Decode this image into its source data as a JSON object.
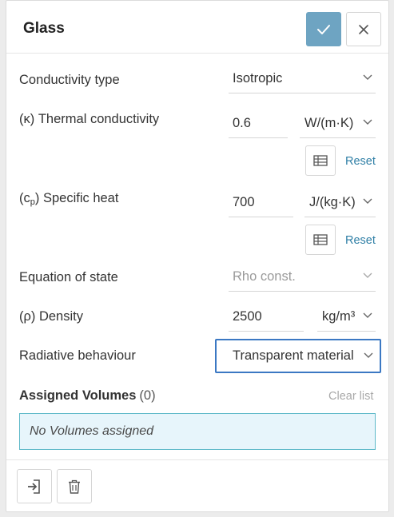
{
  "header": {
    "title": "Glass",
    "confirm_icon": "check-icon",
    "close_icon": "close-icon"
  },
  "colors": {
    "confirm": "#6ea4c2",
    "focus": "#3b78c3",
    "link": "#2f7fa6",
    "info_border": "#5fb9c9",
    "info_bg": "#e7f5fb"
  },
  "conductivity_type": {
    "label": "Conductivity type",
    "value": "Isotropic"
  },
  "thermal_conductivity": {
    "symbol": "(κ)",
    "label": "Thermal conductivity",
    "value": "0.6",
    "unit": "W/(m·K)",
    "table_icon": "table-icon",
    "reset": "Reset"
  },
  "specific_heat": {
    "symbol_open": "(c",
    "symbol_sub": "p",
    "symbol_close": ")",
    "label": "Specific heat",
    "value": "700",
    "unit": "J/(kg·K)",
    "table_icon": "table-icon",
    "reset": "Reset"
  },
  "equation_of_state": {
    "label": "Equation of state",
    "value": "Rho const."
  },
  "density": {
    "label": "(ρ) Density",
    "value": "2500",
    "unit": "kg/m³"
  },
  "radiative_behaviour": {
    "label": "Radiative behaviour",
    "value": "Transparent material"
  },
  "assigned_volumes": {
    "title": "Assigned Volumes",
    "count": "(0)",
    "clear": "Clear list",
    "empty": "No Volumes assigned"
  },
  "footer": {
    "assign_icon": "assign-icon",
    "delete_icon": "trash-icon"
  }
}
